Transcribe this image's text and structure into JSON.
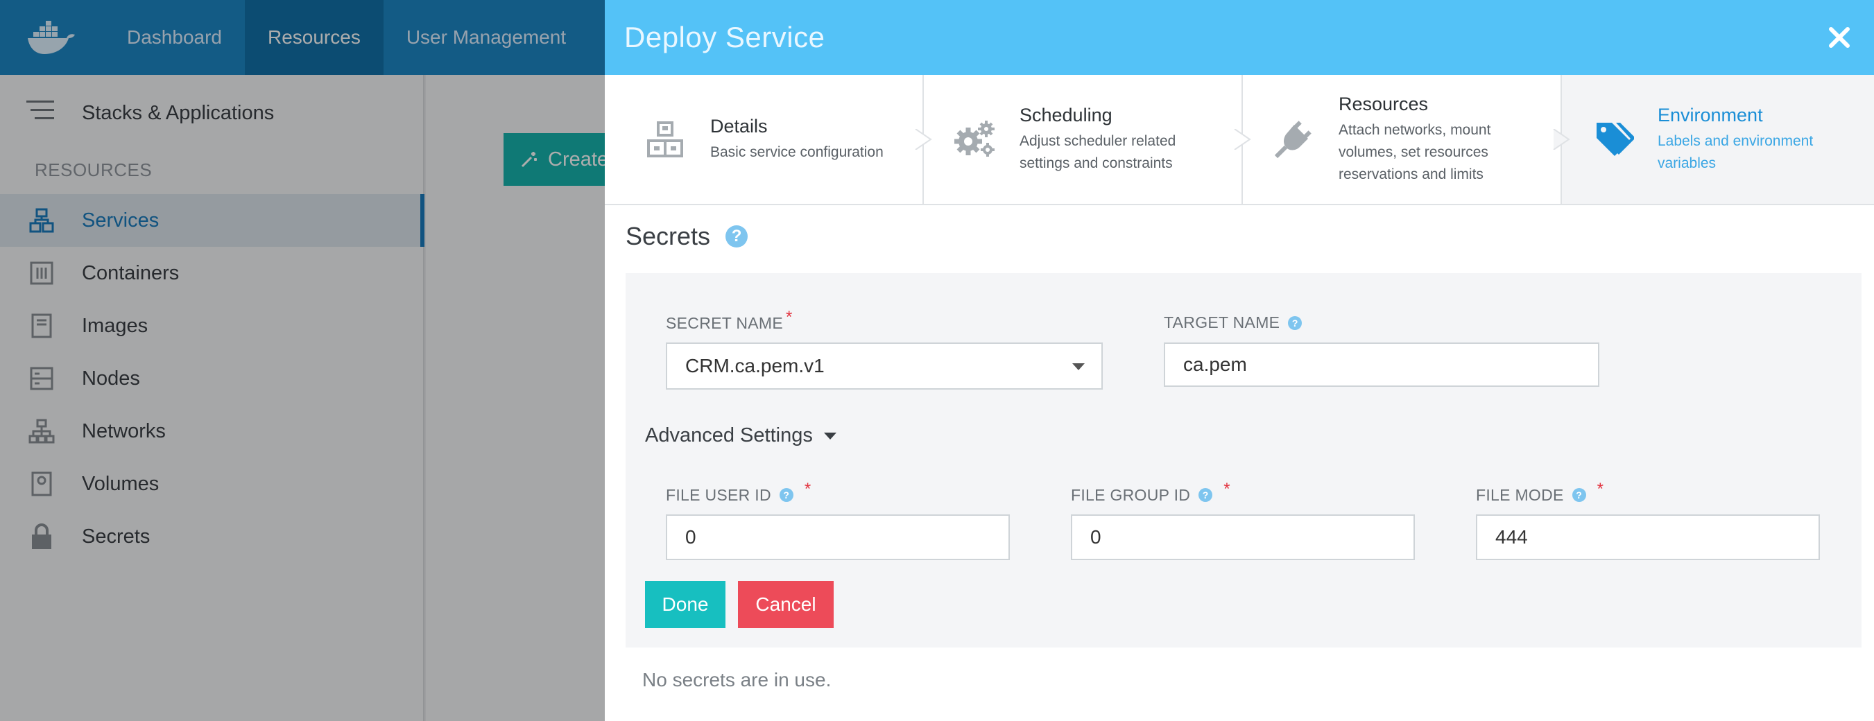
{
  "topnav": {
    "items": [
      {
        "label": "Dashboard",
        "active": false
      },
      {
        "label": "Resources",
        "active": true
      },
      {
        "label": "User Management",
        "active": false
      }
    ]
  },
  "sidebar": {
    "header": "Stacks & Applications",
    "section": "RESOURCES",
    "items": [
      {
        "label": "Services",
        "icon": "services-icon",
        "active": true
      },
      {
        "label": "Containers",
        "icon": "containers-icon"
      },
      {
        "label": "Images",
        "icon": "images-icon"
      },
      {
        "label": "Nodes",
        "icon": "nodes-icon"
      },
      {
        "label": "Networks",
        "icon": "networks-icon"
      },
      {
        "label": "Volumes",
        "icon": "volumes-icon"
      },
      {
        "label": "Secrets",
        "icon": "lock-icon"
      }
    ]
  },
  "main": {
    "create_label": "Create"
  },
  "modal": {
    "title": "Deploy Service",
    "steps": [
      {
        "title": "Details",
        "desc": "Basic service configuration",
        "icon": "details-icon"
      },
      {
        "title": "Scheduling",
        "desc": "Adjust scheduler related settings and constraints",
        "icon": "gears-icon"
      },
      {
        "title": "Resources",
        "desc": "Attach networks, mount volumes, set resources reservations and limits",
        "icon": "plug-icon"
      },
      {
        "title": "Environment",
        "desc": "Labels and environment variables",
        "icon": "tags-icon",
        "active": true
      }
    ],
    "section_title": "Secrets",
    "form": {
      "secret_name_label": "SECRET NAME",
      "secret_name_value": "CRM.ca.pem.v1",
      "target_name_label": "TARGET NAME",
      "target_name_value": "ca.pem",
      "advanced_label": "Advanced Settings",
      "file_user_id_label": "FILE USER ID",
      "file_user_id_value": "0",
      "file_group_id_label": "FILE GROUP ID",
      "file_group_id_value": "0",
      "file_mode_label": "FILE MODE",
      "file_mode_value": "444",
      "required_mark": "*",
      "help_mark": "?"
    },
    "done_label": "Done",
    "cancel_label": "Cancel",
    "empty_message": "No secrets are in use."
  },
  "colors": {
    "topnav": "#1c86c4",
    "modal_header": "#54c2f7",
    "accent": "#1a7bbd",
    "done": "#17bfc0",
    "cancel": "#ed4b59"
  }
}
